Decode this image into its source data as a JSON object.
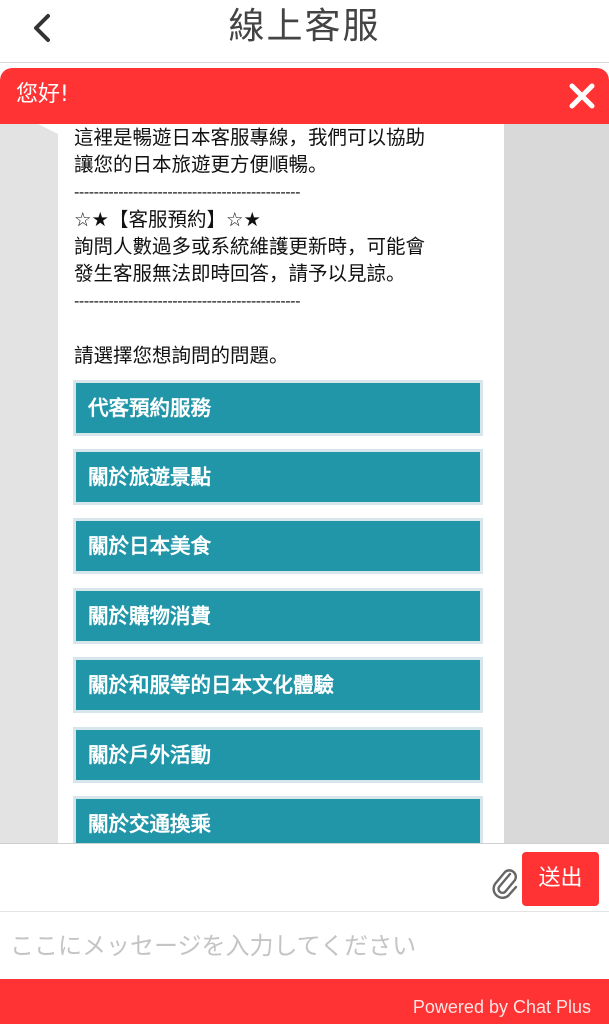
{
  "header": {
    "back_icon": "chevron-left-icon",
    "title": "線上客服"
  },
  "widget": {
    "title": "您好!",
    "close_icon": "close-icon",
    "accent_color": "#ff3333",
    "message_lines": [
      "這裡是暢遊日本客服專線，我們可以協助",
      "讓您的日本旅遊更方便順暢。",
      "----------------------------------------------",
      "☆★【客服預約】☆★",
      "詢問人數過多或系統維護更新時，可能會",
      "發生客服無法即時回答，請予以見諒。",
      "----------------------------------------------",
      "請選擇您想詢問的問題。"
    ],
    "options": [
      "代客預約服務",
      "關於旅遊景點",
      "關於日本美食",
      "關於購物消費",
      "關於和服等的日本文化體驗",
      "關於戶外活動",
      "關於交通換乘"
    ],
    "option_color": "#2196a8"
  },
  "composer": {
    "attach_icon": "paperclip-icon",
    "send_label": "送出",
    "placeholder": "ここにメッセージを入力してください",
    "value": ""
  },
  "footer": {
    "powered_by": "Powered by Chat Plus"
  }
}
